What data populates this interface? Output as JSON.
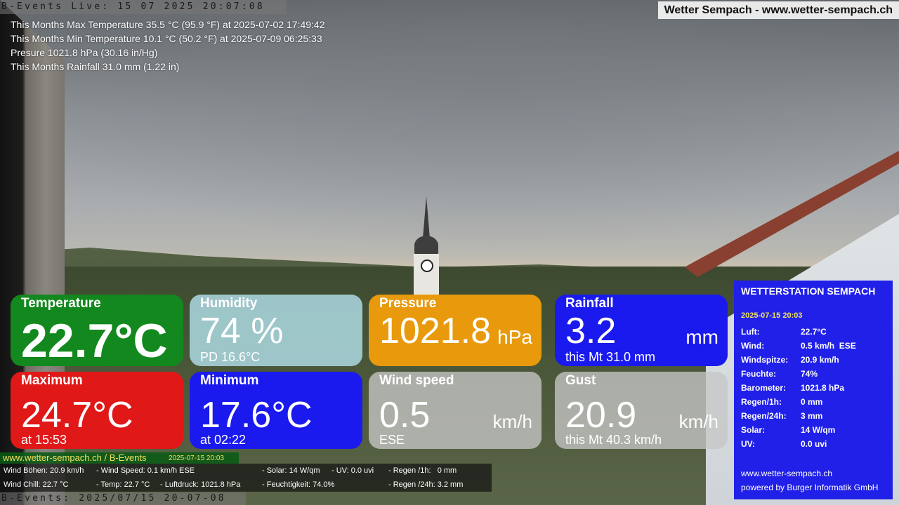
{
  "banners": {
    "top": "B-Events Live: 15 07 2025 20:07:08",
    "bottom": "B-Events: 2025/07/15 20-07-08",
    "site_title": "Wetter Sempach - www.wetter-sempach.ch"
  },
  "monthly_stats": [
    "This Months Max Temperature 35.5 °C (95.9 °F) at 2025-07-02 17:49:42",
    "This Months Min Temperature 10.1 °C (50.2 °F) at 2025-07-09 06:25:33",
    "Presure 1021.8 hPa (30.16 in/Hg)",
    "This Months Rainfall 31.0 mm (1.22 in)"
  ],
  "tiles": {
    "temperature": {
      "label": "Temperature",
      "value": "22.7°C",
      "color": "#13881e"
    },
    "humidity": {
      "label": "Humidity",
      "value": "74 %",
      "sub": "PD 16.6°C"
    },
    "pressure": {
      "label": "Pressure",
      "value": "1021.8",
      "unit": "hPa",
      "color": "#e89a0c"
    },
    "rainfall": {
      "label": "Rainfall",
      "value": "3.2",
      "unit": "mm",
      "sub": "this Mt 31.0 mm"
    },
    "maximum": {
      "label": "Maximum",
      "value": "24.7°C",
      "sub": "at 15:53",
      "color": "#e01818"
    },
    "minimum": {
      "label": "Minimum",
      "value": "17.6°C",
      "sub": "at 02:22"
    },
    "wind_speed": {
      "label": "Wind speed",
      "value": "0.5",
      "unit": "km/h",
      "sub": "ESE"
    },
    "gust": {
      "label": "Gust",
      "value": "20.9",
      "unit": "km/h",
      "sub": "this Mt 40.3 km/h"
    }
  },
  "station": {
    "title": "WETTERSTATION SEMPACH",
    "date": "2025-07-15 20:03",
    "rows": [
      {
        "key": "Luft:",
        "value": "22.7°C"
      },
      {
        "key": "Wind:",
        "value": "0.5 km/h  ESE"
      },
      {
        "key": "Windspitze:",
        "value": "20.9 km/h"
      },
      {
        "key": "Feuchte:",
        "value": "74%"
      },
      {
        "key": "Barometer:",
        "value": "1021.8 hPa"
      },
      {
        "key": "Regen/1h:",
        "value": "0 mm"
      },
      {
        "key": "Regen/24h:",
        "value": "3 mm"
      },
      {
        "key": "Solar:",
        "value": "14 W/qm"
      },
      {
        "key": "UV:",
        "value": "0.0 uvi"
      }
    ],
    "site": "www.wetter-sempach.ch",
    "powered": "powered by Burger Informatik GmbH",
    "color": "#2020e8"
  },
  "ticker": {
    "site": "www.wetter-sempach.ch / B-Events",
    "timestamp": "2025-07-15 20:03",
    "row1": {
      "gust": "Wind Böhen: 20.9 km/h",
      "speed": "- Wind Speed: 0.1 km/h ESE",
      "solar": "- Solar: 14 W/qm",
      "uv": "- UV: 0.0 uvi",
      "rain1h": "- Regen /1h:   0 mm"
    },
    "row2": {
      "chill": "Wind Chill: 22.7 °C",
      "temp": "- Temp: 22.7 °C",
      "pressure": "- Luftdruck: 1021.8 hPa",
      "humidity": "- Feuchtigkeit: 74.0%",
      "rain24h": "- Regen /24h: 3.2 mm"
    }
  }
}
